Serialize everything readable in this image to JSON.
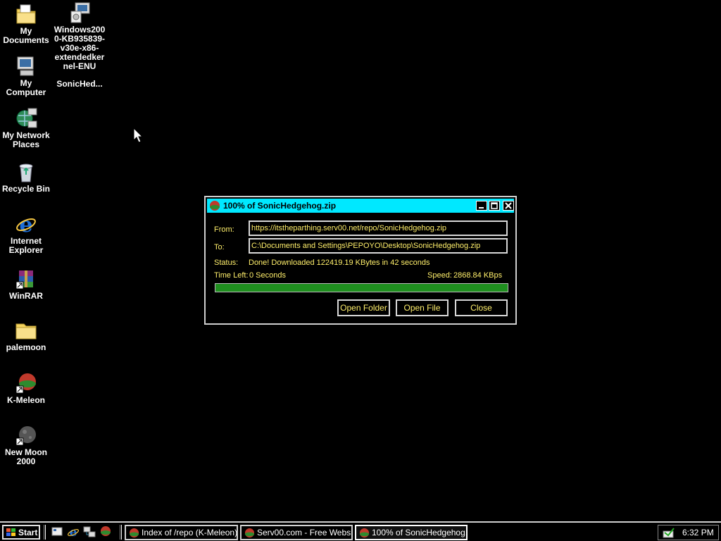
{
  "desktop": {
    "icons": [
      {
        "label": "My Documents",
        "icon": "my-documents-icon"
      },
      {
        "label": "My Computer",
        "icon": "my-computer-icon"
      },
      {
        "label": "My Network Places",
        "icon": "network-places-icon"
      },
      {
        "label": "Recycle Bin",
        "icon": "recycle-bin-icon"
      },
      {
        "label": "Internet Explorer",
        "icon": "internet-explorer-icon"
      },
      {
        "label": "WinRAR",
        "icon": "winrar-icon"
      },
      {
        "label": "palemoon",
        "icon": "folder-icon"
      },
      {
        "label": "K-Meleon",
        "icon": "k-meleon-icon"
      },
      {
        "label": "New Moon 2000",
        "icon": "new-moon-icon"
      },
      {
        "label": "Windows2000-KB935839-v30e-x86-extendedkernel-ENU",
        "icon": "installer-icon"
      },
      {
        "label": "SonicHed...",
        "icon": "zip-file-icon"
      }
    ]
  },
  "dialog": {
    "title": "100% of SonicHedgehog.zip",
    "from_label": "From:",
    "from_value": "https://itstheparthing.serv00.net/repo/SonicHedgehog.zip",
    "to_label": "To:",
    "to_value": "C:\\Documents and Settings\\PEPOYO\\Desktop\\SonicHedgehog.zip",
    "status_label": "Status:",
    "status_value": "Done! Downloaded 122419.19 KBytes in 42 seconds",
    "timeleft_label": "Time Left:",
    "timeleft_value": "0 Seconds",
    "speed_label": "Speed:",
    "speed_value": "2868.84 KBps",
    "progress_percent": 100,
    "buttons": {
      "open_folder": "Open Folder",
      "open_file": "Open File",
      "close": "Close"
    }
  },
  "taskbar": {
    "start_label": "Start",
    "tasks": [
      {
        "label": "Index of /repo (K-Meleon)",
        "active": false
      },
      {
        "label": "Serv00.com - Free Websit...",
        "active": false
      },
      {
        "label": "100% of SonicHedgehog.zip",
        "active": true
      }
    ],
    "clock": "6:32 PM"
  },
  "colors": {
    "titlebar": "#00e8ff",
    "label_text": "#ffef6b",
    "progress": "#1f8f1f",
    "background": "#000000"
  }
}
